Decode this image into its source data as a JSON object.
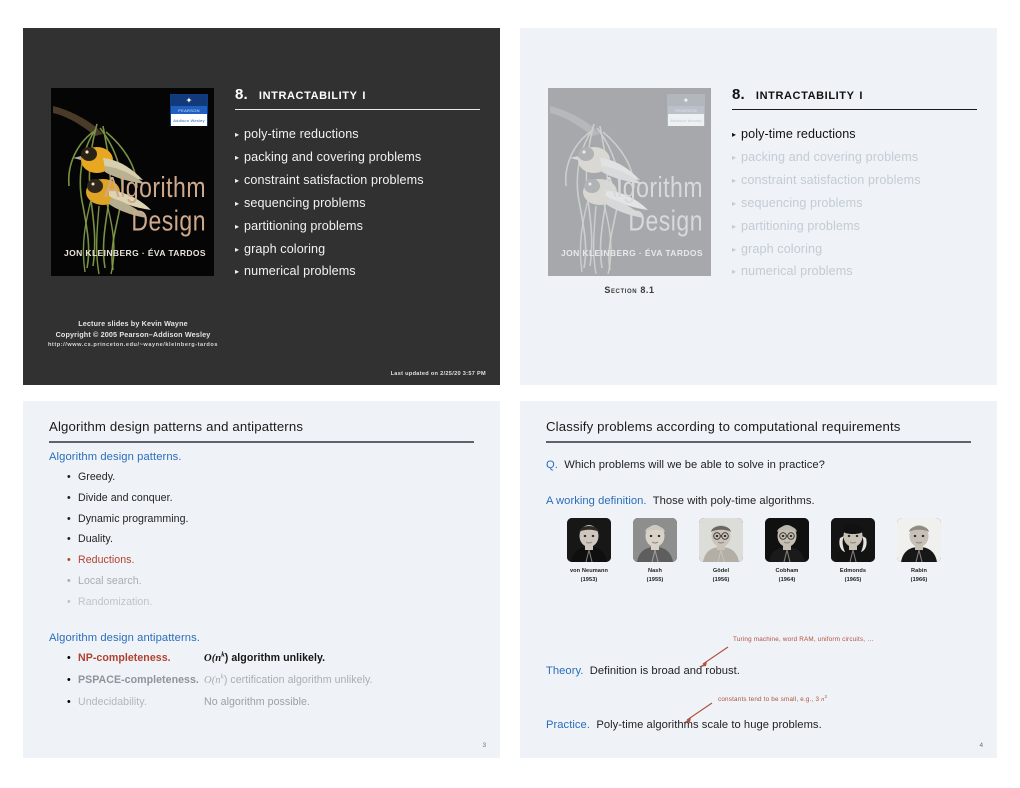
{
  "deck": {
    "number": "8.",
    "name": "Intractability I",
    "topics": [
      "poly-time reductions",
      "packing and covering problems",
      "constraint satisfaction problems",
      "sequencing problems",
      "partitioning problems",
      "graph coloring",
      "numerical problems"
    ]
  },
  "book": {
    "title": "Algorithm Design",
    "authors": "JON KLEINBERG · ÉVA TARDOS",
    "publisher_top": "PEARSON",
    "publisher_bottom": "Addison Wesley"
  },
  "slide1": {
    "credit_line1": "Lecture slides by Kevin Wayne",
    "credit_line2": "Copyright © 2005 Pearson–Addison Wesley",
    "credit_url": "http://www.cs.princeton.edu/~wayne/kleinberg-tardos",
    "last_updated": "Last updated on 2/25/20 3:57 PM"
  },
  "slide2": {
    "section_caption": "Section 8.1",
    "active_topic_index": 0
  },
  "slide3": {
    "heading": "Algorithm design patterns and antipatterns",
    "patterns_lead": "Algorithm design patterns.",
    "patterns": [
      {
        "label": "Greedy.",
        "style": "normal"
      },
      {
        "label": "Divide and conquer.",
        "style": "normal"
      },
      {
        "label": "Dynamic programming.",
        "style": "normal"
      },
      {
        "label": "Duality.",
        "style": "normal"
      },
      {
        "label": "Reductions.",
        "style": "red"
      },
      {
        "label": "Local search.",
        "style": "dim1"
      },
      {
        "label": "Randomization.",
        "style": "dim2"
      }
    ],
    "antipatterns_lead": "Algorithm design antipatterns.",
    "antipatterns": [
      {
        "name": "NP-completeness.",
        "desc_pre": "O(",
        "desc_var": "n",
        "desc_sup": "k",
        "desc_post": ") algorithm unlikely."
      },
      {
        "name": "PSPACE-completeness.",
        "desc_pre": "O(",
        "desc_var": "n",
        "desc_sup": "k",
        "desc_post": ") certification algorithm unlikely."
      },
      {
        "name": "Undecidability.",
        "desc_pre": "",
        "desc_var": "",
        "desc_sup": "",
        "desc_post": "No algorithm possible."
      }
    ],
    "page_number": "3"
  },
  "slide4": {
    "heading": "Classify problems according to computational requirements",
    "q_key": "Q.",
    "q_text": "Which problems will we be able to solve in practice?",
    "def_key": "A working definition.",
    "def_text": "Those with poly-time algorithms.",
    "people": [
      {
        "name": "von Neumann",
        "year": "(1953)"
      },
      {
        "name": "Nash",
        "year": "(1955)"
      },
      {
        "name": "Gödel",
        "year": "(1956)"
      },
      {
        "name": "Cobham",
        "year": "(1964)"
      },
      {
        "name": "Edmonds",
        "year": "(1965)"
      },
      {
        "name": "Rabin",
        "year": "(1966)"
      }
    ],
    "annotation_theory": "Turing machine, word RAM, uniform circuits, …",
    "theory_key": "Theory.",
    "theory_text": "Definition is broad and robust.",
    "annotation_practice_pre": "constants tend to be small, e.g., 3 ",
    "annotation_practice_var": "n",
    "annotation_practice_sup": "2",
    "practice_key": "Practice.",
    "practice_text": "Poly-time algorithms scale to huge problems.",
    "page_number": "4"
  },
  "colors": {
    "dark_slide_bg": "#313131",
    "light_slide_bg": "#eff3f7",
    "accent_blue": "#2a6dbb",
    "accent_red": "#b3402f",
    "annotation_red": "#b3503f",
    "rule_gray": "#5d6470"
  }
}
